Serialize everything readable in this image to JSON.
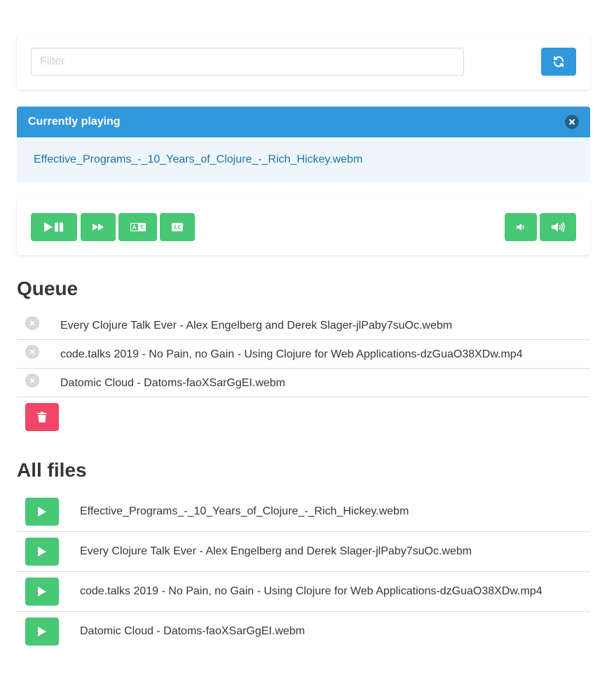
{
  "filter": {
    "placeholder": "Filter",
    "value": ""
  },
  "refresh_icon": "refresh-icon",
  "currently_playing": {
    "title": "Currently playing",
    "file": "Effective_Programs_-_10_Years_of_Clojure_-_Rich_Hickey.webm"
  },
  "controls": {
    "left": [
      "play-pause-icon",
      "fast-forward-icon",
      "language-icon",
      "closed-captions-icon"
    ],
    "right": [
      "volume-down-icon",
      "volume-up-icon"
    ]
  },
  "queue": {
    "title": "Queue",
    "items": [
      "Every Clojure Talk Ever - Alex Engelberg and Derek Slager-jlPaby7suOc.webm",
      "code.talks 2019 - No Pain, no Gain - Using Clojure for Web Applications-dzGuaO38XDw.mp4",
      "Datomic Cloud - Datoms-faoXSarGgEI.webm"
    ]
  },
  "files": {
    "title": "All files",
    "items": [
      "Effective_Programs_-_10_Years_of_Clojure_-_Rich_Hickey.webm",
      "Every Clojure Talk Ever - Alex Engelberg and Derek Slager-jlPaby7suOc.webm",
      "code.talks 2019 - No Pain, no Gain - Using Clojure for Web Applications-dzGuaO38XDw.mp4",
      "Datomic Cloud - Datoms-faoXSarGgEI.webm"
    ]
  },
  "colors": {
    "info": "#3298dc",
    "success": "#48c774",
    "danger": "#f14668",
    "info_light": "#eef6fc"
  }
}
